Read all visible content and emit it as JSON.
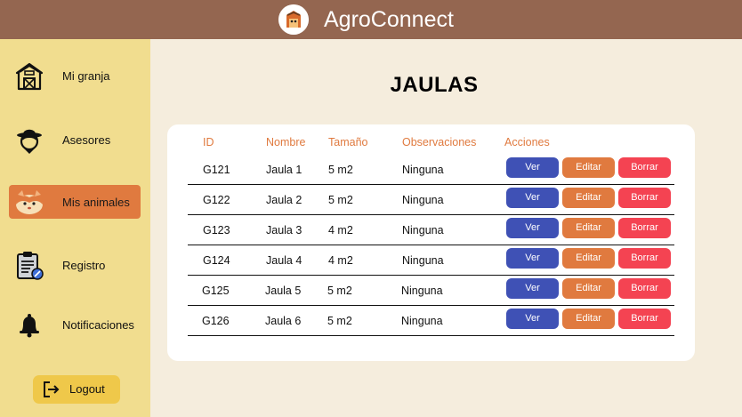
{
  "app": {
    "title": "AgroConnect"
  },
  "sidebar": {
    "items": [
      {
        "label": "Mi granja",
        "icon": "barn-icon"
      },
      {
        "label": "Asesores",
        "icon": "farmer-icon"
      },
      {
        "label": "Mis animales",
        "icon": "hamster-icon",
        "active": true
      },
      {
        "label": "Registro",
        "icon": "clipboard-icon"
      },
      {
        "label": "Notificaciones",
        "icon": "bell-icon"
      }
    ],
    "logout_label": "Logout"
  },
  "page": {
    "title": "JAULAS"
  },
  "table": {
    "headers": [
      "ID",
      "Nombre",
      "Tamaño",
      "Observaciones",
      "Acciones"
    ],
    "rows": [
      {
        "id": "G121",
        "nombre": "Jaula 1",
        "tamano": "5 m2",
        "obs": "Ninguna"
      },
      {
        "id": "G122",
        "nombre": "Jaula 2",
        "tamano": "5 m2",
        "obs": "Ninguna"
      },
      {
        "id": "G123",
        "nombre": "Jaula 3",
        "tamano": "4 m2",
        "obs": "Ninguna"
      },
      {
        "id": "G124",
        "nombre": "Jaula 4",
        "tamano": "4 m2",
        "obs": "Ninguna"
      },
      {
        "id": "G125",
        "nombre": "Jaula 5",
        "tamano": "5 m2",
        "obs": "Ninguna"
      },
      {
        "id": "G126",
        "nombre": "Jaula 6",
        "tamano": "5 m2",
        "obs": "Ninguna"
      }
    ],
    "actions": {
      "view": "Ver",
      "edit": "Editar",
      "delete": "Borrar"
    }
  },
  "colors": {
    "header": "#946650",
    "sidebar": "#f1dd8f",
    "active": "#e07a3f",
    "view_button": "#3f51b5",
    "edit_button": "#e07a3f",
    "delete_button": "#f44352",
    "logout_button": "#efc84a"
  }
}
